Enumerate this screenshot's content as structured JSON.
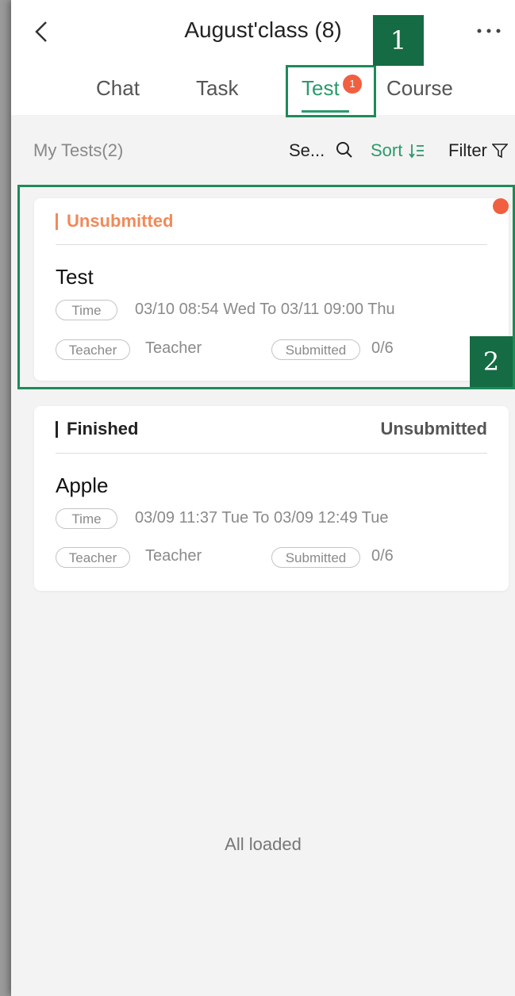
{
  "header": {
    "title": "August'class (8)",
    "back_icon": "chevron-left-icon",
    "more_icon": "more-horizontal-icon"
  },
  "tabs": [
    {
      "label": "Chat",
      "active": false
    },
    {
      "label": "Task",
      "active": false
    },
    {
      "label": "Test",
      "active": true,
      "badge": "1"
    },
    {
      "label": "Course",
      "active": false
    }
  ],
  "toolbar": {
    "count_label": "My Tests(2)",
    "search_label": "Se...",
    "sort_label": "Sort",
    "filter_label": "Filter"
  },
  "tests": [
    {
      "status": "Unsubmitted",
      "status_color": "#f08a5a",
      "name": "Test",
      "time_tag": "Time",
      "time": "03/10 08:54 Wed To 03/11 09:00 Thu",
      "teacher_tag": "Teacher",
      "teacher": "Teacher",
      "submitted_tag": "Submitted",
      "submitted": "0/6",
      "unread": true
    },
    {
      "status": "Finished",
      "status_color": "#222222",
      "right_status": "Unsubmitted",
      "name": "Apple",
      "time_tag": "Time",
      "time": "03/09 11:37 Tue To 03/09 12:49 Tue",
      "teacher_tag": "Teacher",
      "teacher": "Teacher",
      "submitted_tag": "Submitted",
      "submitted": "0/6",
      "unread": false
    }
  ],
  "footer": {
    "all_loaded": "All loaded"
  },
  "annotations": {
    "marker_1": "1",
    "marker_2": "2"
  },
  "colors": {
    "accent": "#2a9a6c",
    "badge": "#f06040",
    "annotation": "#1e8a5a"
  }
}
